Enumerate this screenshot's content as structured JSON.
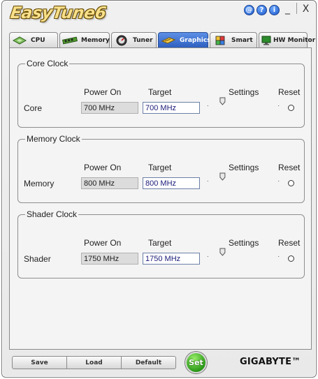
{
  "app": {
    "logo_text": "EasyTune6",
    "title_buttons": [
      "@",
      "?",
      "i"
    ],
    "window_controls": {
      "minimize": "_",
      "close": "X"
    }
  },
  "tabs": [
    {
      "label": "CPU",
      "icon": "cpu-chip-icon",
      "active": false
    },
    {
      "label": "Memory",
      "icon": "memory-module-icon",
      "active": false
    },
    {
      "label": "Tuner",
      "icon": "gauge-icon",
      "active": false
    },
    {
      "label": "Graphics",
      "icon": "graphics-card-icon",
      "active": true
    },
    {
      "label": "Smart",
      "icon": "smart-cube-icon",
      "active": false
    },
    {
      "label": "HW Monitor",
      "icon": "monitor-icon",
      "active": false
    }
  ],
  "headers": {
    "power_on": "Power On",
    "target": "Target",
    "settings": "Settings",
    "reset": "Reset"
  },
  "groups": [
    {
      "title": "Core Clock",
      "row_label": "Core",
      "power_on": "700 MHz",
      "target": "700 MHz",
      "slider_level": 0.2
    },
    {
      "title": "Memory Clock",
      "row_label": "Memory",
      "power_on": "800 MHz",
      "target": "800 MHz",
      "slider_level": 0.2
    },
    {
      "title": "Shader Clock",
      "row_label": "Shader",
      "power_on": "1750 MHz",
      "target": "1750 MHz",
      "slider_level": 0.2
    }
  ],
  "footer": {
    "save": "Save",
    "load": "Load",
    "default": "Default",
    "set": "Set",
    "brand": "GIGABYTE™"
  },
  "colors": {
    "active_tab": "#2e5fbf",
    "logo": "#f8e08a",
    "set_button": "#2d9a1a",
    "target_text": "#1a1a7a"
  }
}
